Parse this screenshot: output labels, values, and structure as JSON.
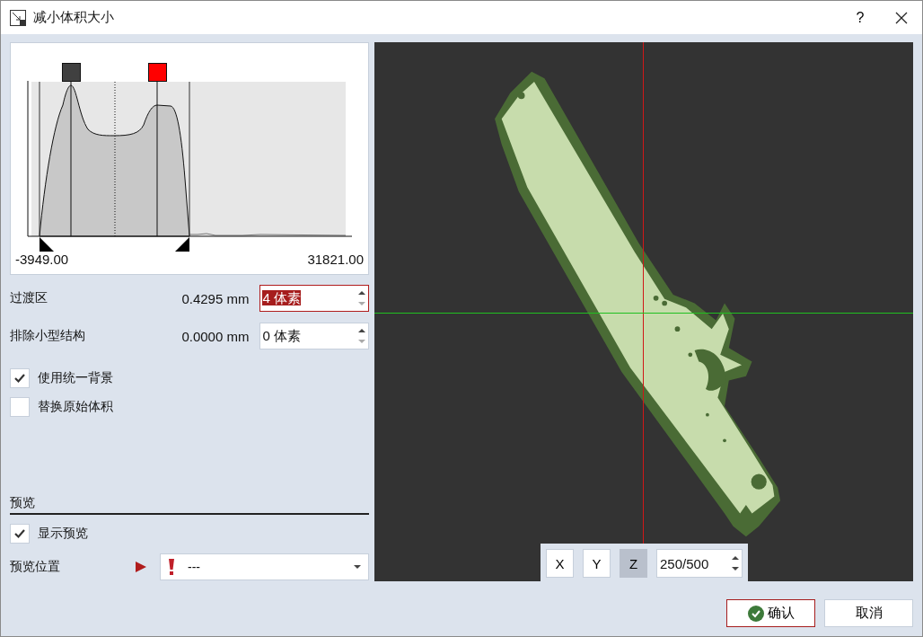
{
  "window": {
    "title": "减小体积大小",
    "help": "?"
  },
  "histogram": {
    "min_label": "-3949.00",
    "max_label": "31821.00"
  },
  "fields": [
    {
      "label": "过渡区",
      "reading": "0.4295 mm",
      "value": "4 体素",
      "focused": true
    },
    {
      "label": "排除小型结构",
      "reading": "0.0000 mm",
      "value": "0 体素",
      "focused": false
    }
  ],
  "options": [
    {
      "label": "使用统一背景",
      "checked": true
    },
    {
      "label": "替换原始体积",
      "checked": false
    }
  ],
  "preview": {
    "heading": "预览",
    "show": {
      "label": "显示预览",
      "checked": true
    },
    "location": {
      "label": "预览位置",
      "value": "---",
      "warning": true
    }
  },
  "view": {
    "axes": [
      {
        "label": "X",
        "selected": false
      },
      {
        "label": "Y",
        "selected": false
      },
      {
        "label": "Z",
        "selected": true
      }
    ],
    "slice": "250/500"
  },
  "buttons": [
    {
      "label": "确认",
      "kind": "primary"
    },
    {
      "label": "取消",
      "kind": "secondary"
    }
  ]
}
